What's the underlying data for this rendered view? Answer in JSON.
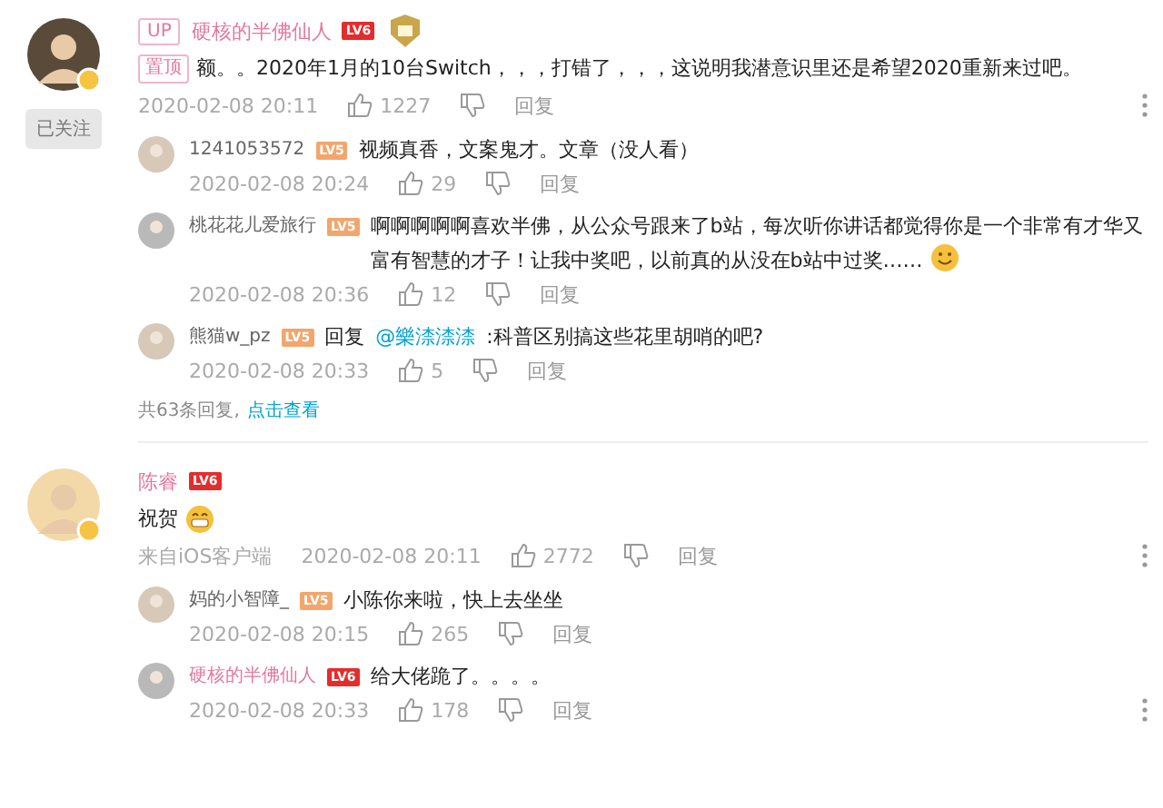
{
  "comments": [
    {
      "name": "硬核的半佛仙人",
      "vip": true,
      "level": "LV6",
      "up_tag": "UP",
      "medal": true,
      "follow_button": "已关注",
      "pinned_tag": "置顶",
      "text": "额。。2020年1月的10台Switch，，，打错了，，，这说明我潜意识里还是希望2020重新来过吧。",
      "time": "2020-02-08 20:11",
      "likes": "1227",
      "reply_label": "回复",
      "replies": [
        {
          "name": "1241053572",
          "vip": false,
          "level": "LV5",
          "text": "视频真香，文案鬼才。文章（没人看）",
          "time": "2020-02-08 20:24",
          "likes": "29",
          "reply_label": "回复"
        },
        {
          "name": "桃花花儿爱旅行",
          "vip": false,
          "level": "LV5",
          "text": "啊啊啊啊啊喜欢半佛，从公众号跟来了b站，每次听你讲话都觉得你是一个非常有才华又富有智慧的才子！让我中奖吧，以前真的从没在b站中过奖……",
          "emoji": {
            "kind": "smile"
          },
          "time": "2020-02-08 20:36",
          "likes": "12",
          "reply_label": "回复"
        },
        {
          "name": "熊猫w_pz",
          "vip": false,
          "level": "LV5",
          "prefix": "回复",
          "mention": "@樂渿渿渿",
          "text": ":科普区别搞这些花里胡哨的吧?",
          "time": "2020-02-08 20:33",
          "likes": "5",
          "reply_label": "回复"
        }
      ],
      "reply_count": "共63条回复,",
      "view_link": "点击查看"
    },
    {
      "name": "陈睿",
      "vip": true,
      "level": "LV6",
      "medal": false,
      "text": "祝贺",
      "emoji": {
        "kind": "grin"
      },
      "source": "来自iOS客户端",
      "time": "2020-02-08 20:11",
      "likes": "2772",
      "reply_label": "回复",
      "replies": [
        {
          "name": "妈的小智障_",
          "vip": false,
          "level": "LV5",
          "text": "小陈你来啦，快上去坐坐",
          "time": "2020-02-08 20:15",
          "likes": "265",
          "reply_label": "回复"
        },
        {
          "name": "硬核的半佛仙人",
          "vip": true,
          "level": "LV6",
          "text": "给大佬跪了。。。。",
          "time": "2020-02-08 20:33",
          "likes": "178",
          "reply_label": "回复"
        }
      ]
    }
  ]
}
